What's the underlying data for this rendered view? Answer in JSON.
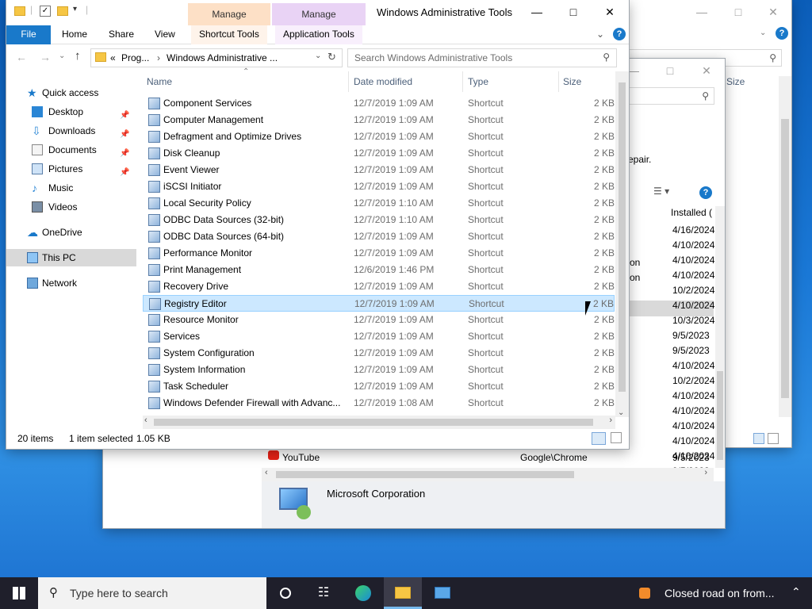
{
  "back_window": {
    "size_header": "Size",
    "search_icon": "search-icon"
  },
  "programs_window": {
    "partial_text_repair": "epair.",
    "installed_header": "Installed (",
    "installed_dates": [
      "4/16/2024",
      "4/10/2024",
      "4/10/2024",
      "4/10/2024",
      "10/2/2024",
      "4/10/2024",
      "10/3/2024",
      "9/5/2023",
      "9/5/2023",
      "4/10/2024",
      "10/2/2024",
      "4/10/2024",
      "4/10/2024",
      "4/10/2024",
      "4/10/2024",
      "4/10/2024",
      "9/5/2023"
    ],
    "partial_on_1": "on",
    "partial_on_2": "on",
    "youtube_name": "YouTube",
    "youtube_publisher": "Google\\Chrome",
    "youtube_date": "9/5/2023",
    "details_publisher": "Microsoft Corporation"
  },
  "main_window": {
    "title": "Windows Administrative Tools",
    "manage_group_1": "Manage",
    "manage_group_2": "Manage",
    "tabs": {
      "file": "File",
      "home": "Home",
      "share": "Share",
      "view": "View",
      "shortcut_tools": "Shortcut Tools",
      "application_tools": "Application Tools"
    },
    "address": {
      "prefix": "«",
      "crumb1": "Prog...",
      "sep": "›",
      "crumb2": "Windows Administrative ...",
      "search_placeholder": "Search Windows Administrative Tools"
    },
    "nav": {
      "quick_access": "Quick access",
      "desktop": "Desktop",
      "downloads": "Downloads",
      "documents": "Documents",
      "pictures": "Pictures",
      "music": "Music",
      "videos": "Videos",
      "onedrive": "OneDrive",
      "this_pc": "This PC",
      "network": "Network"
    },
    "columns": {
      "name": "Name",
      "date": "Date modified",
      "type": "Type",
      "size": "Size"
    },
    "rows": [
      {
        "name": "Component Services",
        "date": "12/7/2019 1:09 AM",
        "type": "Shortcut",
        "size": "2 KB"
      },
      {
        "name": "Computer Management",
        "date": "12/7/2019 1:09 AM",
        "type": "Shortcut",
        "size": "2 KB"
      },
      {
        "name": "Defragment and Optimize Drives",
        "date": "12/7/2019 1:09 AM",
        "type": "Shortcut",
        "size": "2 KB"
      },
      {
        "name": "Disk Cleanup",
        "date": "12/7/2019 1:09 AM",
        "type": "Shortcut",
        "size": "2 KB"
      },
      {
        "name": "Event Viewer",
        "date": "12/7/2019 1:09 AM",
        "type": "Shortcut",
        "size": "2 KB"
      },
      {
        "name": "iSCSI Initiator",
        "date": "12/7/2019 1:09 AM",
        "type": "Shortcut",
        "size": "2 KB"
      },
      {
        "name": "Local Security Policy",
        "date": "12/7/2019 1:10 AM",
        "type": "Shortcut",
        "size": "2 KB"
      },
      {
        "name": "ODBC Data Sources (32-bit)",
        "date": "12/7/2019 1:10 AM",
        "type": "Shortcut",
        "size": "2 KB"
      },
      {
        "name": "ODBC Data Sources (64-bit)",
        "date": "12/7/2019 1:09 AM",
        "type": "Shortcut",
        "size": "2 KB"
      },
      {
        "name": "Performance Monitor",
        "date": "12/7/2019 1:09 AM",
        "type": "Shortcut",
        "size": "2 KB"
      },
      {
        "name": "Print Management",
        "date": "12/6/2019 1:46 PM",
        "type": "Shortcut",
        "size": "2 KB"
      },
      {
        "name": "Recovery Drive",
        "date": "12/7/2019 1:09 AM",
        "type": "Shortcut",
        "size": "2 KB"
      },
      {
        "name": "Registry Editor",
        "date": "12/7/2019 1:09 AM",
        "type": "Shortcut",
        "size": "2 KB",
        "selected": true
      },
      {
        "name": "Resource Monitor",
        "date": "12/7/2019 1:09 AM",
        "type": "Shortcut",
        "size": "2 KB"
      },
      {
        "name": "Services",
        "date": "12/7/2019 1:09 AM",
        "type": "Shortcut",
        "size": "2 KB"
      },
      {
        "name": "System Configuration",
        "date": "12/7/2019 1:09 AM",
        "type": "Shortcut",
        "size": "2 KB"
      },
      {
        "name": "System Information",
        "date": "12/7/2019 1:09 AM",
        "type": "Shortcut",
        "size": "2 KB"
      },
      {
        "name": "Task Scheduler",
        "date": "12/7/2019 1:09 AM",
        "type": "Shortcut",
        "size": "2 KB"
      },
      {
        "name": "Windows Defender Firewall with Advanc...",
        "date": "12/7/2019 1:08 AM",
        "type": "Shortcut",
        "size": "2 KB"
      }
    ],
    "status": {
      "count": "20 items",
      "selected": "1 item selected",
      "size": "1.05 KB"
    }
  },
  "taskbar": {
    "search_placeholder": "Type here to search",
    "notification": "Closed road on from..."
  },
  "colors": {
    "accent": "#1979ca",
    "selection": "#cce8ff",
    "manage_shortcut": "#fde0c6",
    "manage_app": "#e9d3f5"
  }
}
